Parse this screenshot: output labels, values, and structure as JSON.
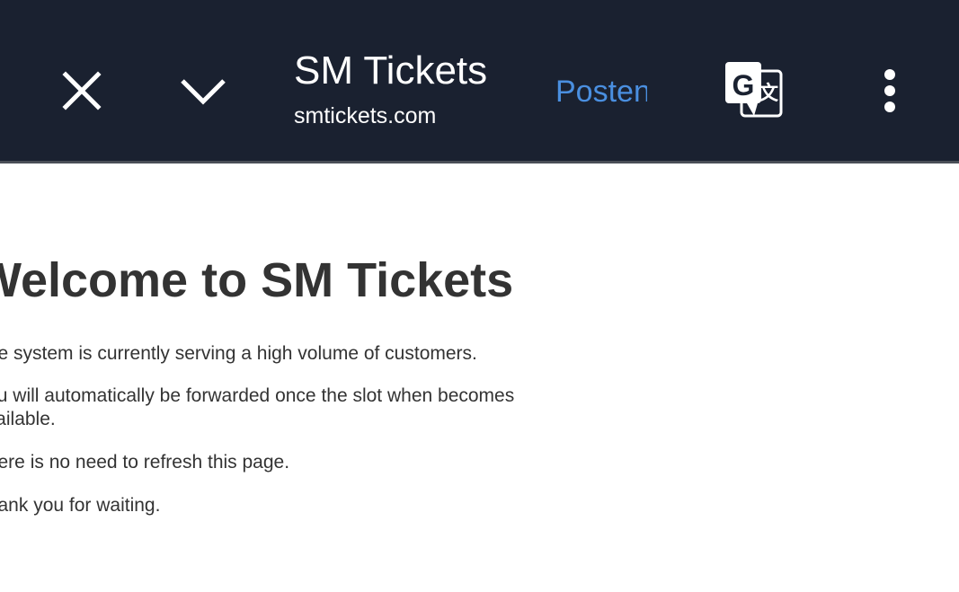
{
  "header": {
    "title": "SM Tickets",
    "domain": "smtickets.com",
    "action_label": "Posten",
    "icons": {
      "close": "close-icon",
      "collapse": "chevron-down-icon",
      "translate": "google-translate-icon",
      "menu": "more-vert-icon"
    },
    "colors": {
      "bar_background": "#1a2130",
      "action_link": "#4a8fe0"
    }
  },
  "main": {
    "heading": "Welcome to SM Tickets",
    "paragraphs": [
      "The system is currently serving a high volume of customers.",
      "You will automatically be forwarded once the slot when becomes available.",
      "There is no need to refresh this page.",
      "Thank you for waiting."
    ]
  }
}
